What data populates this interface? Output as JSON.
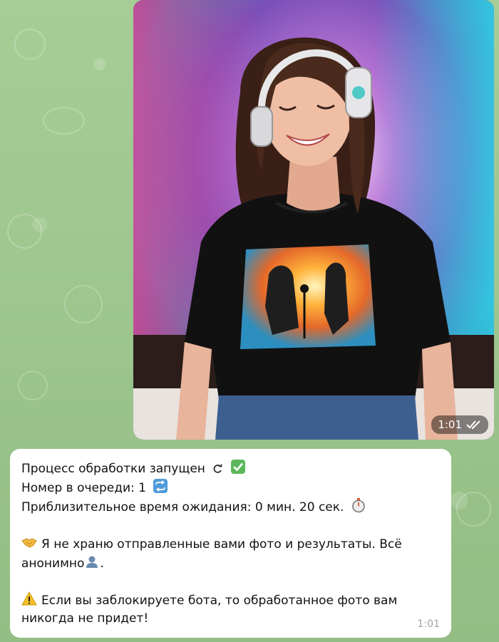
{
  "photo_message": {
    "time": "1:01",
    "status_icon": "double-check-icon"
  },
  "text_message": {
    "line1": "Процесс обработки запущен",
    "line2": "Номер в очереди: 1",
    "line3": "Приблизительное время ожидания: 0 мин. 20 сек.",
    "line4a": "Я не храню отправленные вами фото и результаты. Всё",
    "line4b": "анонимно",
    "line5a": "Если вы заблокируете бота, то обработанное фото вам",
    "line5b": "никогда не придет!",
    "time": "1:01"
  }
}
